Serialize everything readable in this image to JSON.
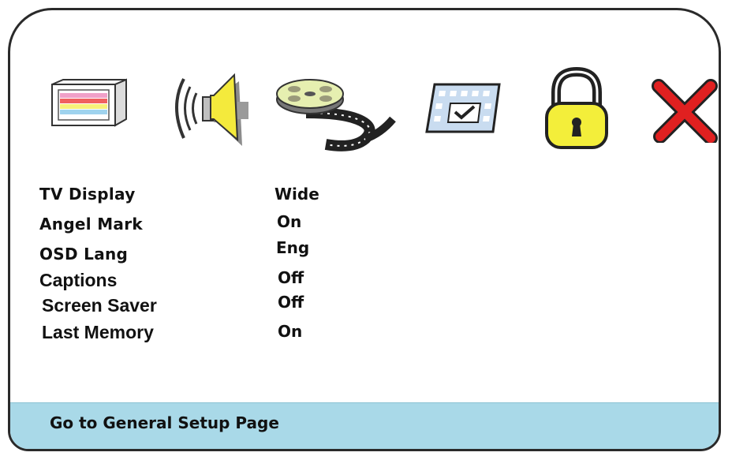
{
  "menu_icons": [
    {
      "icon": "tv-display-icon",
      "selected": true
    },
    {
      "icon": "audio-speaker-icon"
    },
    {
      "icon": "film-reel-icon"
    },
    {
      "icon": "preferences-checkbox-icon"
    },
    {
      "icon": "padlock-icon"
    },
    {
      "icon": "exit-x-icon"
    }
  ],
  "settings": [
    {
      "label": "TV Display",
      "value": "Wide"
    },
    {
      "label": "Angel Mark",
      "value": "On"
    },
    {
      "label": "OSD Lang",
      "value": "Eng"
    },
    {
      "label": "Captions",
      "value": "Off"
    },
    {
      "label": "Screen Saver",
      "value": "Off"
    },
    {
      "label": "Last Memory",
      "value": "On"
    }
  ],
  "footer": {
    "text": "Go to General Setup Page"
  },
  "colors": {
    "footer_bg": "#a9d9e8",
    "lock_yellow": "#f3ee3a",
    "exit_red": "#e02020",
    "speaker_yellow": "#f4ea3c"
  }
}
